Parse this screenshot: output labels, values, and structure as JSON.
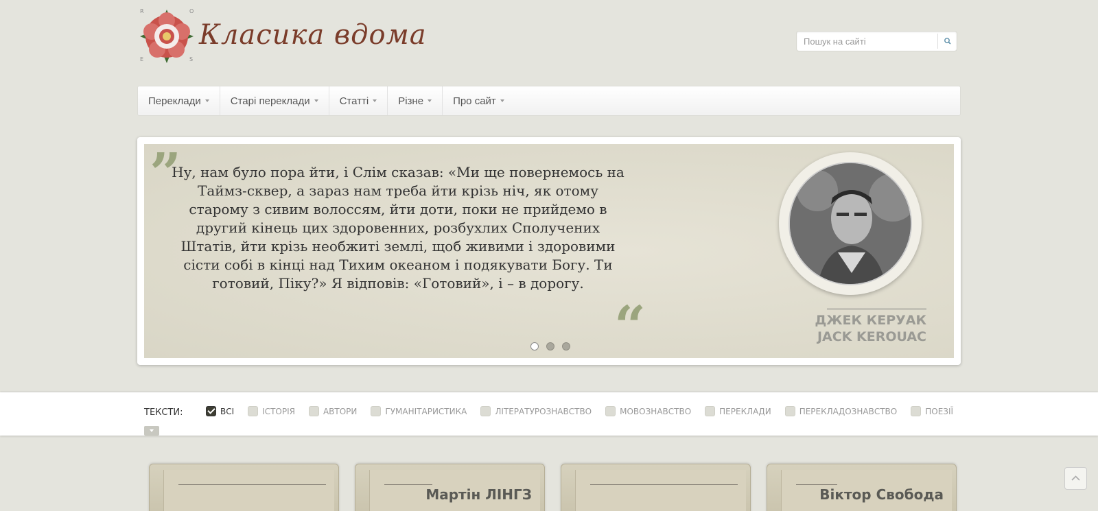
{
  "site": {
    "logo_letters": [
      "R",
      "O",
      "E",
      "S"
    ],
    "title": "Класика вдома"
  },
  "search": {
    "placeholder": "Пошук на сайті",
    "value": ""
  },
  "nav": {
    "items": [
      {
        "label": "Переклади"
      },
      {
        "label": "Старі переклади"
      },
      {
        "label": "Статті"
      },
      {
        "label": "Різне"
      },
      {
        "label": "Про сайт"
      }
    ]
  },
  "slider": {
    "quote": "Ну, нам було пора йти, і Слім сказав: «Ми ще повернемось на Таймз-сквер, а зараз нам треба йти крізь ніч, як отому старому з сивим волоссям, йти доти, поки не прийдемо в другий кінець цих здоровенних, розбухлих Сполучених Штатів, йти крізь необжиті землі, щоб живими і здоровими сісти собі в кінці над Тихим океаном і подякувати Богу. Ти готовий, Піку?» Я відповів: «Готовий», і – в дорогу.",
    "author_ua": "ДЖЕК КЕРУАК",
    "author_en": "JACK KEROUAC",
    "active_slide": 1,
    "slide_count": 3
  },
  "filters": {
    "label": "ТЕКСТИ:",
    "items": [
      {
        "label": "ВСІ",
        "checked": true
      },
      {
        "label": "ІСТОРІЯ",
        "checked": false
      },
      {
        "label": "АВТОРИ",
        "checked": false
      },
      {
        "label": "ГУМАНІТАРИСТИКА",
        "checked": false
      },
      {
        "label": "ЛІТЕРАТУРОЗНАВСТВО",
        "checked": false
      },
      {
        "label": "МОВОЗНАВСТВО",
        "checked": false
      },
      {
        "label": "ПЕРЕКЛАДИ",
        "checked": false
      },
      {
        "label": "ПЕРЕКЛАДОЗНАВСТВО",
        "checked": false
      },
      {
        "label": "ПОЕЗІЇ",
        "checked": false
      }
    ]
  },
  "books": [
    {
      "title": ""
    },
    {
      "title": "Мартін ЛІНГЗ"
    },
    {
      "title": ""
    },
    {
      "title": "Віктор Свобода"
    }
  ],
  "colors": {
    "background": "#e4e4dd",
    "accent_green": "#9ba57e",
    "logo_brown": "#7a3c2a"
  }
}
